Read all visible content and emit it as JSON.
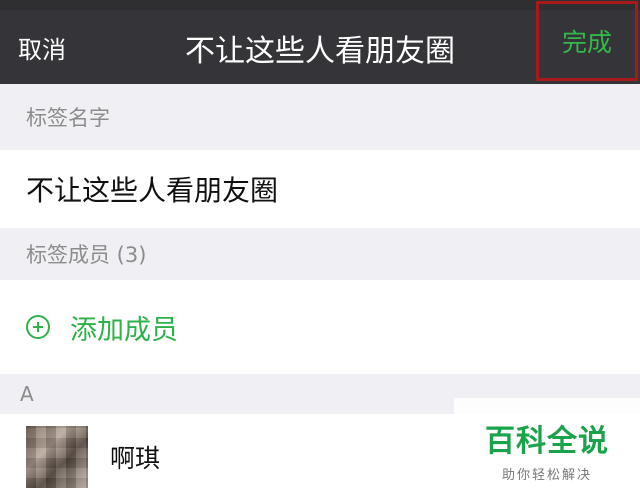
{
  "navbar": {
    "cancel_label": "取消",
    "title": "不让这些人看朋友圈",
    "done_label": "完成"
  },
  "tag_name_section": {
    "header": "标签名字",
    "value": "不让这些人看朋友圈"
  },
  "members_section": {
    "header": "标签成员 (3)",
    "add_label": "添加成员",
    "index_letter": "A",
    "contacts": [
      {
        "name": "啊琪"
      }
    ]
  },
  "watermark": {
    "main": "百科全说",
    "sub": "助你轻松解决"
  },
  "colors": {
    "navbar_bg": "#353539",
    "accent_green": "#2fb14a",
    "highlight_border": "#a61a1a",
    "section_bg": "#efeff4"
  }
}
